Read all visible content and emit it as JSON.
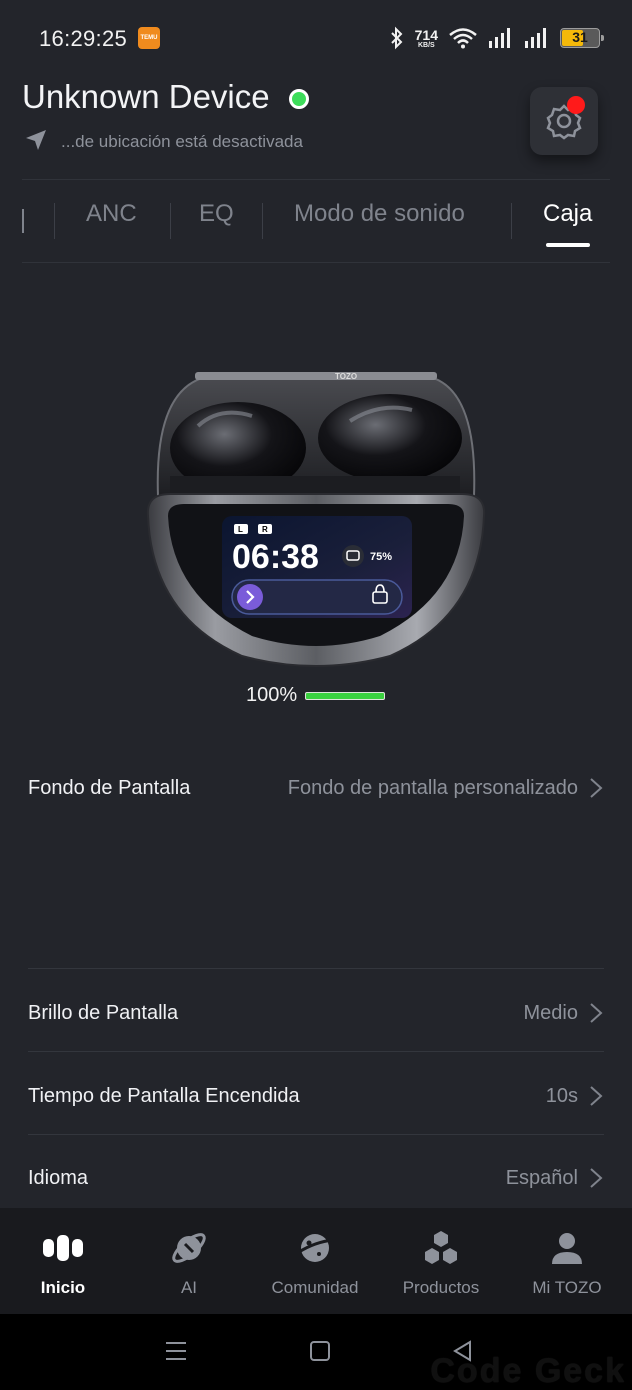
{
  "status_bar": {
    "time": "16:29:25",
    "notification_badge": "TEMU",
    "net_speed_value": "714",
    "net_speed_unit": "KB/S",
    "battery_level": "31",
    "icons": [
      "bluetooth-icon",
      "wifi-icon",
      "signal-icon",
      "signal-icon",
      "battery-icon"
    ]
  },
  "header": {
    "device_name": "Unknown Device",
    "connected": true,
    "location_status": "...de ubicación está desactivada",
    "settings_has_alert": true
  },
  "tabs": {
    "items": [
      {
        "label": "ANC",
        "active": false
      },
      {
        "label": "EQ",
        "active": false
      },
      {
        "label": "Modo de sonido",
        "active": false
      },
      {
        "label": "Caja",
        "active": true
      }
    ]
  },
  "product": {
    "screen_time": "06:38",
    "screen_battery": "75%",
    "screen_left": "L",
    "screen_right": "R",
    "lid_brand": "TOZO",
    "case_battery_pct": "100%",
    "case_battery_fraction": 1.0
  },
  "settings": {
    "wallpaper": {
      "label": "Fondo de Pantalla",
      "value": "Fondo de pantalla personalizado"
    },
    "brightness": {
      "label": "Brillo de Pantalla",
      "value": "Medio"
    },
    "screen_time": {
      "label": "Tiempo de Pantalla Encendida",
      "value": "10s"
    },
    "language": {
      "label": "Idioma",
      "value": "Español"
    }
  },
  "bottom_nav": {
    "items": [
      {
        "label": "Inicio",
        "icon": "home-icon",
        "active": true
      },
      {
        "label": "AI",
        "icon": "ai-planet-icon",
        "active": false
      },
      {
        "label": "Comunidad",
        "icon": "community-planet-icon",
        "active": false
      },
      {
        "label": "Productos",
        "icon": "products-hex-icon",
        "active": false
      },
      {
        "label": "Mi TOZO",
        "icon": "profile-icon",
        "active": false
      }
    ]
  },
  "watermark": "Code Geck",
  "colors": {
    "background": "#23252b",
    "accent_green": "#3ddc5a",
    "alert_red": "#ff1a1a",
    "battery_yellow": "#f5b90a",
    "nav_background": "#191a1e"
  }
}
